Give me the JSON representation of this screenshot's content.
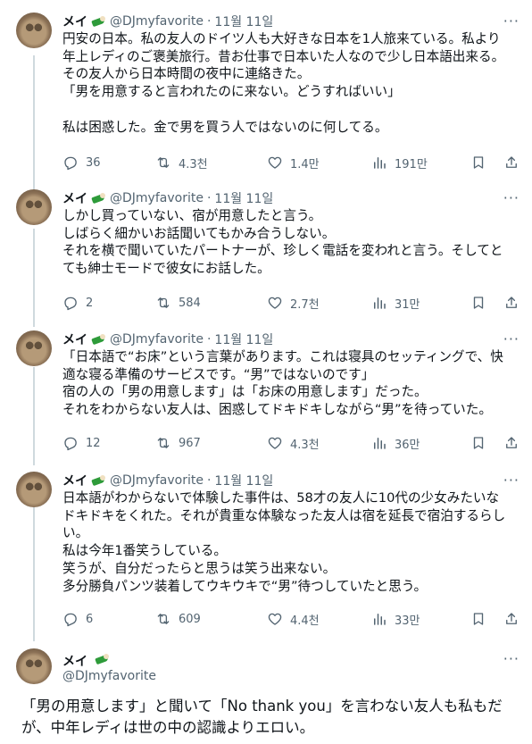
{
  "author": {
    "name": "メイ",
    "handle": "@DJmyfavorite",
    "emoji": "green-onion-emoji"
  },
  "tweets": [
    {
      "date": "11월 11일",
      "text": "円安の日本。私の友人のドイツ人も大好きな日本を1人旅来ている。私より\n年上レディのご褒美旅行。昔お仕事で日本いた人なので少し日本語出来る。\nその友人から日本時間の夜中に連絡きた。\n「男を用意すると言われたのに来ない。どうすればいい」\n\n私は困惑した。金で男を買う人ではないのに何してる。",
      "stats": {
        "replies": "36",
        "reposts": "4.3천",
        "likes": "1.4만",
        "views": "191만"
      }
    },
    {
      "date": "11월 11일",
      "text": "しかし買っていない、宿が用意したと言う。\nしばらく細かいお話聞いてもかみ合うしない。\nそれを横で聞いていたパートナーが、珍しく電話を変われと言う。そしてと\nても紳士モードで彼女にお話した。",
      "stats": {
        "replies": "2",
        "reposts": "584",
        "likes": "2.7천",
        "views": "31만"
      }
    },
    {
      "date": "11월 11일",
      "text": "「日本語で“お床”という言葉があります。これは寝具のセッティングで、快\n適な寝る準備のサービスです。“男”ではないのです」\n宿の人の「男の用意します」は「お床の用意します」だった。\nそれをわからない友人は、困惑してドキドキしながら“男”を待っていた。",
      "stats": {
        "replies": "12",
        "reposts": "967",
        "likes": "4.3천",
        "views": "36만"
      }
    },
    {
      "date": "11월 11일",
      "text": "日本語がわからないで体験した事件は、58才の友人に10代の少女みたいな\nドキドキをくれた。それが貴重な体験なった友人は宿を延長で宿泊するらし\nい。\n私は今年1番笑うしている。\n笑うが、自分だったらと思うは笑う出来ない。\n多分勝負パンツ装着してウキウキで“男”待つしていたと思う。",
      "stats": {
        "replies": "6",
        "reposts": "609",
        "likes": "4.4천",
        "views": "33만"
      }
    }
  ],
  "final_tweet": {
    "text": "「男の用意します」と聞いて「No thank you」を言わない友人も私もだ\nが、中年レディは世の中の認識よりエロい。"
  },
  "icons": {
    "more": "more-icon",
    "reply": "reply-icon",
    "repost": "repost-icon",
    "like": "like-icon",
    "views": "views-icon",
    "bookmark": "bookmark-icon",
    "share": "share-icon"
  },
  "colors": {
    "text": "#0f1419",
    "muted": "#536471",
    "divider": "#eff3f4",
    "thread_line": "#cfd9de"
  }
}
